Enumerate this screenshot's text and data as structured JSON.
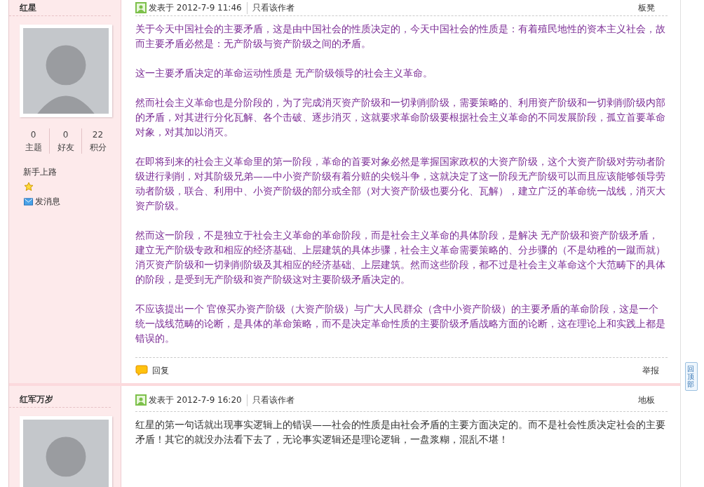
{
  "posts": [
    {
      "author": "红星",
      "stats": [
        {
          "value": "0",
          "label": "主题"
        },
        {
          "value": "0",
          "label": "好友"
        },
        {
          "value": "22",
          "label": "积分"
        }
      ],
      "rank": "新手上路",
      "message_link": "发消息",
      "posted": "发表于 2012-7-9 11:46",
      "author_only": "只看该作者",
      "floor": "板凳",
      "color": "#7b2d95",
      "paragraphs": [
        "关于今天中国社会的主要矛盾，这是由中国社会的性质决定的，今天中国社会的性质是：有着殖民地性的资本主义社会，故而主要矛盾必然是：无产阶级与资产阶级之间的矛盾。",
        "这一主要矛盾决定的革命运动性质是 无产阶级领导的社会主义革命。",
        "然而社会主义革命也是分阶段的，为了完成消灭资产阶级和一切剥削阶级，需要策略的、利用资产阶级和一切剥削阶级内部的矛盾，对其进行分化瓦解、各个击破、逐步消灭，这就要求革命阶级要根据社会主义革命的不同发展阶段，孤立首要革命对象，对其加以消灭。",
        "在即将到来的社会主义革命里的第一阶段，革命的首要对象必然是掌握国家政权的大资产阶级，这个大资产阶级对劳动者阶级进行剥削，对其阶级兄弟——中小资产阶级有着分赃的尖锐斗争，这就决定了这一阶段无产阶级可以而且应该能够领导劳动者阶级，联合、利用中、小资产阶级的部分或全部（对大资产阶级也要分化、瓦解），建立广泛的革命统一战线，消灭大资产阶级。",
        "然而这一阶段，不是独立于社会主义革命的革命阶段，而是社会主义革命的具体阶段，是解决 无产阶级和资产阶级矛盾，建立无产阶级专政和相应的经济基础、上层建筑的具体步骤，社会主义革命需要策略的、分步骤的（不是幼稚的一蹴而就）消灭资产阶级和一切剥削阶级及其相应的经济基础、上层建筑。然而这些阶段，都不过是社会主义革命这个大范畴下的具体的阶段，是受到无产阶级和资产阶级这对主要阶级矛盾决定的。",
        "不应该提出一个 官僚买办资产阶级（大资产阶级）与广大人民群众（含中小资产阶级）的主要矛盾的革命阶段，这是一个统一战线范畴的论断，是具体的革命策略，而不是决定革命性质的主要阶级矛盾战略方面的论断，这在理论上和实践上都是错误的。"
      ],
      "reply": "回复",
      "report": "举报"
    },
    {
      "author": "红军万岁",
      "posted": "发表于 2012-7-9 16:20",
      "author_only": "只看该作者",
      "floor": "地板",
      "color": "#333333",
      "paragraphs": [
        "红星的第一句话就出现事实逻辑上的错误——社会的性质是由社会矛盾的主要方面决定的。而不是社会性质决定社会的主要矛盾！其它的就没办法看下去了，无论事实逻辑还是理论逻辑，一盘浆糊，混乱不堪！"
      ]
    }
  ],
  "back_to_top": "回顶部"
}
